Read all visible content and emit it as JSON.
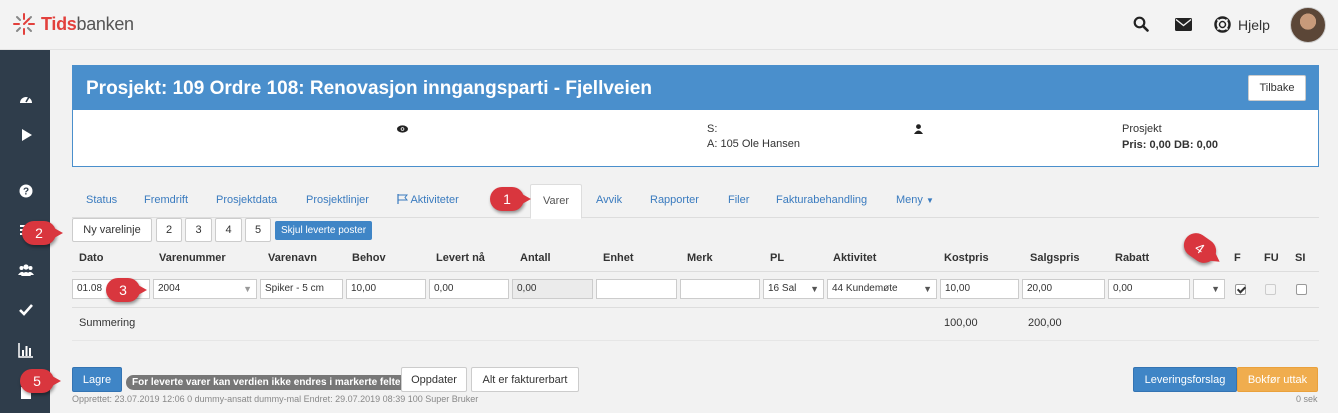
{
  "app": {
    "logo_bold": "Tids",
    "logo_normal": "banken",
    "help_label": "Hjelp"
  },
  "project": {
    "title": "Prosjekt: 109 Ordre 108: Renovasjon inngangsparti - Fjellveien",
    "back_label": "Tilbake",
    "s_label": "S:",
    "a_line": "A: 105 Ole Hansen",
    "type_label": "Prosjekt",
    "pris_line": "Pris: 0,00 DB: 0,00"
  },
  "tabs": [
    "Status",
    "Fremdrift",
    "Prosjektdata",
    "Prosjektlinjer",
    "Aktiviteter",
    "Varer",
    "Avvik",
    "Rapporter",
    "Filer",
    "Fakturabehandling",
    "Meny"
  ],
  "toolbar": {
    "new_line": "Ny varelinje",
    "pages": [
      "2",
      "3",
      "4",
      "5"
    ],
    "hide_delivered": "Skjul leverte poster"
  },
  "table": {
    "headers": [
      "Dato",
      "Varenummer",
      "Varenavn",
      "Behov",
      "Levert nå",
      "Antall",
      "Enhet",
      "Merk",
      "PL",
      "Aktivitet",
      "Kostpris",
      "Salgspris",
      "Rabatt",
      "F",
      "FU",
      "SI"
    ],
    "row": {
      "dato": "01.08",
      "varenummer": "2004",
      "varenavn": "Spiker - 5 cm",
      "behov": "10,00",
      "levert_na": "0,00",
      "antall": "0,00",
      "enhet": "",
      "merk": "",
      "pl": "16 Sal",
      "aktivitet": "44 Kundemøte",
      "kostpris": "10,00",
      "salgspris": "20,00",
      "rabatt": "0,00",
      "f_checked": true,
      "fu_checked": false,
      "si_checked": false
    },
    "summary_label": "Summering",
    "sum_kostpris": "100,00",
    "sum_salgspris": "200,00"
  },
  "footer": {
    "save": "Lagre",
    "notice": "For leverte varer kan verdien ikke endres i markerte felter",
    "update": "Oppdater",
    "all_billable": "Alt er fakturerbart",
    "delivery_proposal": "Leveringsforslag",
    "book_withdrawal": "Bokfør uttak",
    "created_text": "Opprettet: 23.07.2019 12:06 0 dummy-ansatt dummy-mal Endret: 29.07.2019 08:39 100 Super Bruker",
    "seconds": "0 sek"
  },
  "callouts": [
    "1",
    "2",
    "3",
    "4",
    "5"
  ],
  "colors": {
    "primary": "#3f85c6",
    "header_blue": "#4a8fcc",
    "warning": "#f0ad4e",
    "callout_red": "#d9363e",
    "sidebar": "#2f3d4b"
  }
}
